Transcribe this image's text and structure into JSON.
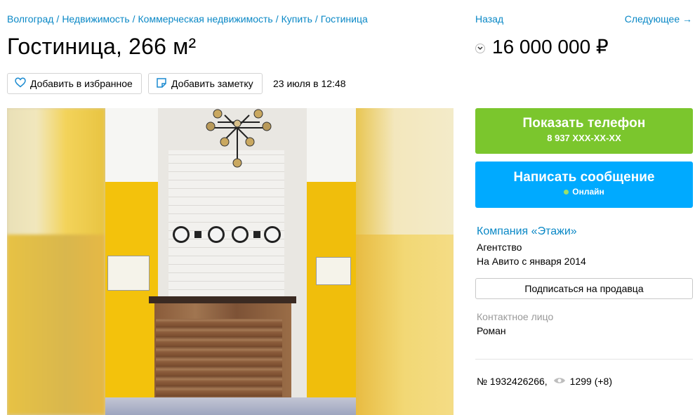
{
  "breadcrumb": {
    "items": [
      "Волгоград",
      "Недвижимость",
      "Коммерческая недвижимость",
      "Купить",
      "Гостиница"
    ],
    "separator": "/"
  },
  "nav": {
    "back_label": "Назад",
    "next_label": "Следующее →"
  },
  "listing": {
    "title": "Гостиница, 266 м²",
    "price": "16 000 000 ₽",
    "date": "23 июля в 12:48",
    "number_label": "№ 1932426266,",
    "views": "1299 (+8)"
  },
  "actions": {
    "favorite_label": "Добавить в избранное",
    "note_label": "Добавить заметку",
    "phone_title": "Показать телефон",
    "phone_masked": "8 937 XXX-XX-XX",
    "message_title": "Написать сообщение",
    "online_label": "Онлайн",
    "subscribe_label": "Подписаться на продавца"
  },
  "seller": {
    "name": "Компания «Этажи»",
    "type": "Агентство",
    "since": "На Авито с января 2014",
    "contact_label": "Контактное лицо",
    "contact_name": "Роман"
  },
  "icons": {
    "favorite": "heart-icon",
    "note": "note-icon",
    "price_toggle": "chevron-down-icon",
    "views": "eye-icon"
  },
  "colors": {
    "link": "#0a88c6",
    "phone_button": "#7bc62d",
    "message_button": "#00aaff",
    "online": "#9be06b"
  }
}
